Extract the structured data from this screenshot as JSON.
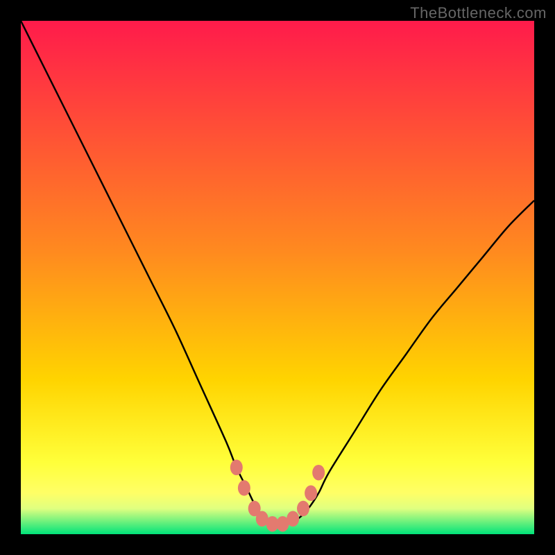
{
  "watermark": "TheBottleneck.com",
  "chart_data": {
    "type": "line",
    "title": "",
    "xlabel": "",
    "ylabel": "",
    "xlim": [
      0,
      100
    ],
    "ylim": [
      0,
      100
    ],
    "grid": false,
    "legend": false,
    "background_gradient": {
      "top_color": "#ff1b4b",
      "mid_color": "#ffd400",
      "bottom_glow": "#ffff66",
      "bottom_color": "#00e37a"
    },
    "series": [
      {
        "name": "bottleneck-curve",
        "x": [
          0,
          5,
          10,
          15,
          20,
          25,
          30,
          35,
          40,
          42,
          44,
          46,
          48,
          50,
          52,
          54,
          56,
          58,
          60,
          65,
          70,
          75,
          80,
          85,
          90,
          95,
          100
        ],
        "y": [
          100,
          90,
          80,
          70,
          60,
          50,
          40,
          29,
          18,
          13,
          9,
          5,
          3,
          2,
          2,
          3,
          5,
          8,
          12,
          20,
          28,
          35,
          42,
          48,
          54,
          60,
          65
        ],
        "stroke": "#000000",
        "stroke_width": 2.5
      }
    ],
    "markers": {
      "name": "highlight-dots",
      "color": "#e37a6f",
      "radius": 9,
      "points": [
        {
          "x": 42,
          "y": 13
        },
        {
          "x": 43.5,
          "y": 9
        },
        {
          "x": 45.5,
          "y": 5
        },
        {
          "x": 47,
          "y": 3
        },
        {
          "x": 49,
          "y": 2
        },
        {
          "x": 51,
          "y": 2
        },
        {
          "x": 53,
          "y": 3
        },
        {
          "x": 55,
          "y": 5
        },
        {
          "x": 56.5,
          "y": 8
        },
        {
          "x": 58,
          "y": 12
        }
      ]
    }
  }
}
